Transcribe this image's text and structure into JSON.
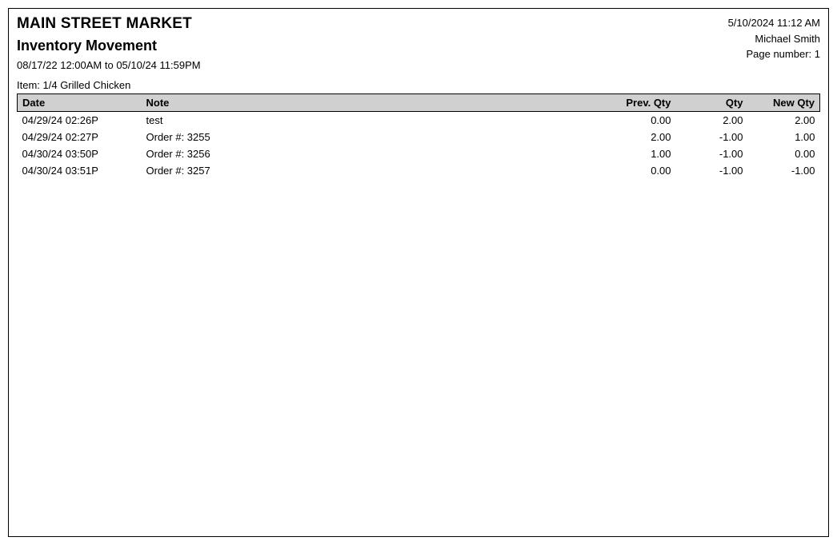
{
  "header": {
    "company": "MAIN STREET MARKET",
    "report_title": "Inventory Movement",
    "date_range": "08/17/22 12:00AM to 05/10/24 11:59PM",
    "item_label_prefix": "Item: ",
    "item_name": "1/4 Grilled Chicken",
    "print_datetime": "5/10/2024 11:12 AM",
    "user": "Michael Smith",
    "page_label_prefix": "Page number: ",
    "page_number": "1"
  },
  "columns": {
    "date": "Date",
    "note": "Note",
    "prev_qty": "Prev. Qty",
    "qty": "Qty",
    "new_qty": "New Qty"
  },
  "rows": [
    {
      "date": "04/29/24 02:26P",
      "note": "test",
      "prev_qty": "0.00",
      "qty": "2.00",
      "new_qty": "2.00"
    },
    {
      "date": "04/29/24 02:27P",
      "note": "Order #: 3255",
      "prev_qty": "2.00",
      "qty": "-1.00",
      "new_qty": "1.00"
    },
    {
      "date": "04/30/24 03:50P",
      "note": "Order #: 3256",
      "prev_qty": "1.00",
      "qty": "-1.00",
      "new_qty": "0.00"
    },
    {
      "date": "04/30/24 03:51P",
      "note": "Order #: 3257",
      "prev_qty": "0.00",
      "qty": "-1.00",
      "new_qty": "-1.00"
    }
  ]
}
